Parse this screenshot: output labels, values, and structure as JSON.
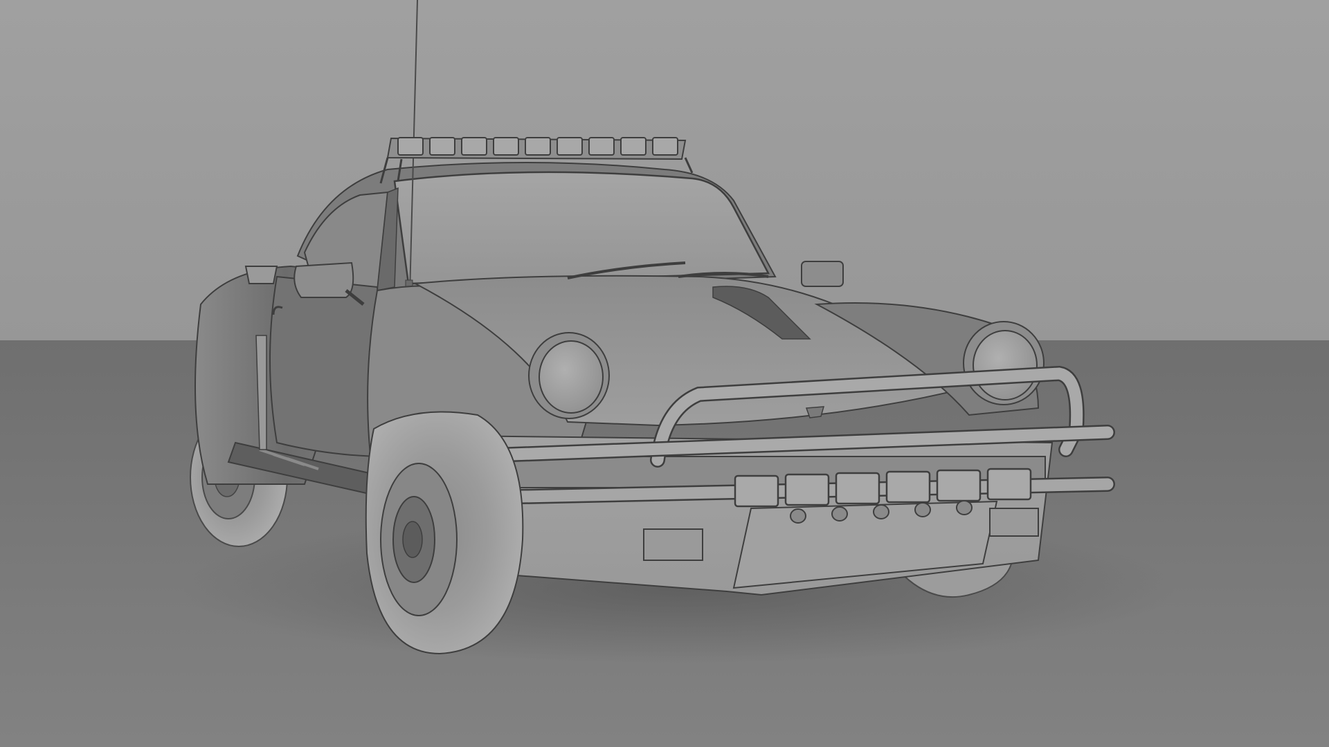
{
  "scene": {
    "subject": "rally-911-clay-render",
    "colors": {
      "backdrop": "#9a9a9a",
      "floor": "#7e7e7e",
      "body_light": "#a3a3a3",
      "body_mid": "#8e8e8e",
      "body_dark": "#6d6d6d",
      "shadow": "#5a5a5a",
      "outline": "#3e3e3e",
      "tire": "#a9a9a9"
    },
    "light_bar_lamp_count": 9,
    "bumper_lamp_count": 6,
    "tow_hook_count": 5
  }
}
